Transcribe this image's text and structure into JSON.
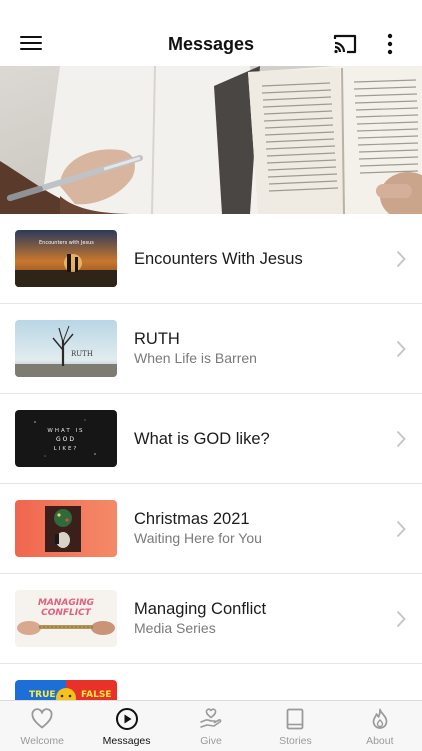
{
  "header": {
    "title": "Messages"
  },
  "messages": [
    {
      "title": "Encounters With Jesus",
      "subtitle": ""
    },
    {
      "title": "RUTH",
      "subtitle": "When Life is Barren"
    },
    {
      "title": "What is GOD like?",
      "subtitle": ""
    },
    {
      "title": "Christmas 2021",
      "subtitle": "Waiting Here for You"
    },
    {
      "title": "Managing Conflict",
      "subtitle": "Media Series"
    },
    {
      "title": "",
      "subtitle": ""
    }
  ],
  "thumbnails": {
    "t1": "Encounters with Jesus",
    "t2": "RUTH",
    "t3": [
      "WHAT IS",
      "GOD",
      "LIKE?"
    ],
    "t5": [
      "MANAGING",
      "CONFLICT"
    ],
    "t6": [
      "TRUE",
      "FALSE"
    ]
  },
  "tabs": [
    {
      "label": "Welcome",
      "icon": "heart-icon",
      "active": false
    },
    {
      "label": "Messages",
      "icon": "play-circle-icon",
      "active": true
    },
    {
      "label": "Give",
      "icon": "give-hand-icon",
      "active": false
    },
    {
      "label": "Stories",
      "icon": "book-icon",
      "active": false
    },
    {
      "label": "About",
      "icon": "flame-icon",
      "active": false
    }
  ],
  "colors": {
    "accent": "#111111",
    "inactive": "#9a9a9a",
    "divider": "#e6e6e8"
  }
}
